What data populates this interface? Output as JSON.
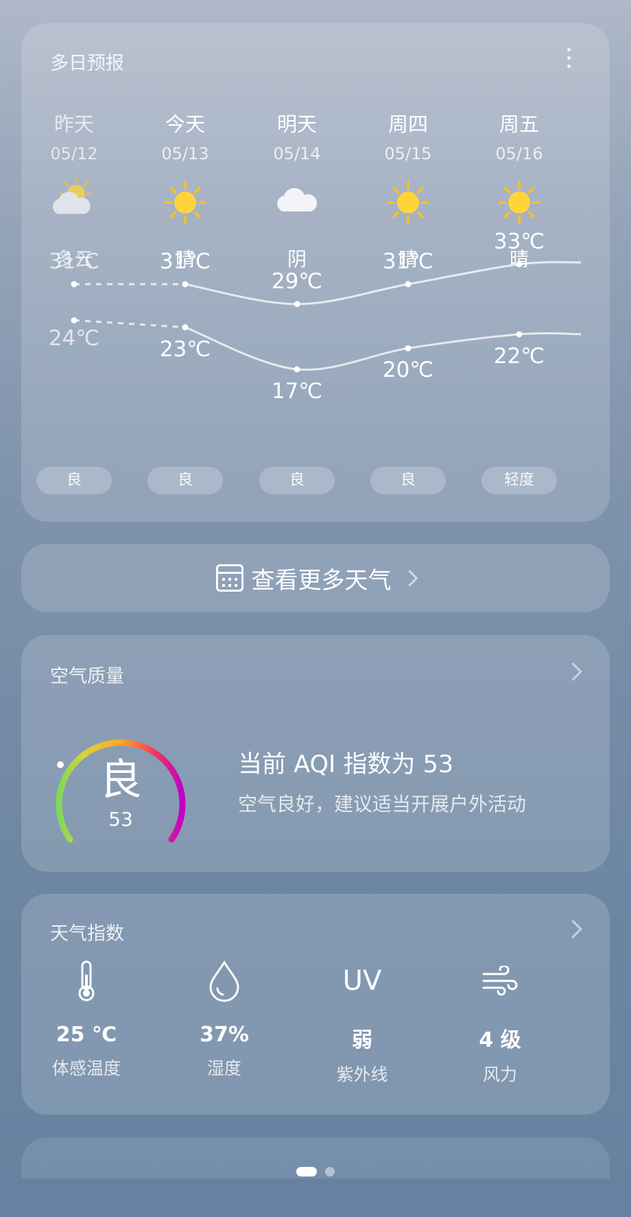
{
  "forecast": {
    "title": "多日预报",
    "days": [
      {
        "name": "昨天",
        "date": "05/12",
        "condition": "多云",
        "high": "31℃",
        "low": "24℃",
        "air": "良",
        "icon": "partly-cloudy-icon"
      },
      {
        "name": "今天",
        "date": "05/13",
        "condition": "晴",
        "high": "31℃",
        "low": "23℃",
        "air": "良",
        "icon": "sun-icon"
      },
      {
        "name": "明天",
        "date": "05/14",
        "condition": "阴",
        "high": "29℃",
        "low": "17℃",
        "air": "良",
        "icon": "cloud-icon"
      },
      {
        "name": "周四",
        "date": "05/15",
        "condition": "晴",
        "high": "31℃",
        "low": "20℃",
        "air": "良",
        "icon": "sun-icon"
      },
      {
        "name": "周五",
        "date": "05/16",
        "condition": "晴",
        "high": "33℃",
        "low": "22℃",
        "air": "轻度",
        "icon": "sun-icon"
      }
    ],
    "highs": [
      31,
      31,
      29,
      31,
      33
    ],
    "lows": [
      24,
      23,
      17,
      20,
      22
    ]
  },
  "more": {
    "label": "查看更多天气"
  },
  "air": {
    "title": "空气质量",
    "level": "良",
    "aqi": "53",
    "headline": "当前 AQI 指数为 53",
    "advice": "空气良好，建议适当开展户外活动"
  },
  "index": {
    "title": "天气指数",
    "items": [
      {
        "value": "25 ℃",
        "label": "体感温度",
        "icon": "thermometer-icon"
      },
      {
        "value": "37%",
        "label": "湿度",
        "icon": "droplet-icon"
      },
      {
        "value": "弱",
        "label": "紫外线",
        "icon": "uv-icon",
        "glyph": "UV"
      },
      {
        "value": "4 级",
        "label": "风力",
        "icon": "wind-icon"
      }
    ]
  },
  "colors": {
    "accent": "#ffd43b",
    "gauge_start": "#7ed957",
    "gauge_mid": "#ffa726",
    "gauge_end": "#c200c8"
  }
}
